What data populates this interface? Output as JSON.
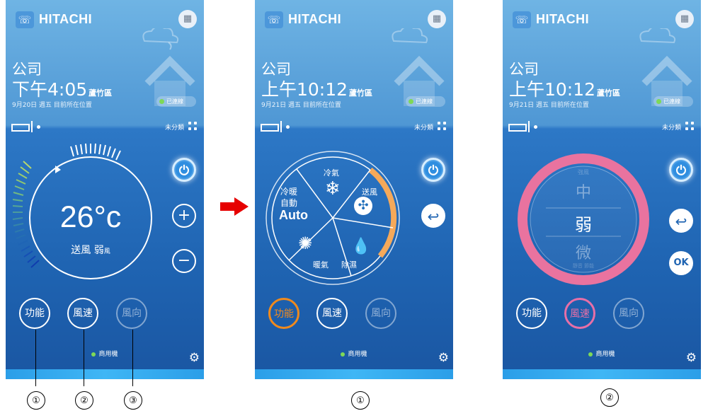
{
  "app": {
    "brand": "HITACHI",
    "brand_color": "#1f64b2",
    "accent_orange": "#f08a1d",
    "accent_pink": "#e76fa7"
  },
  "screens": [
    {
      "location": "公司",
      "time": "下午4:05",
      "district": "蘆竹區",
      "date_line": "9月20日 週五  目前所在位置",
      "connection": "已連線",
      "group_label": "未分類",
      "temperature": "26°c",
      "mode_text": "送風",
      "speed_text": "弱",
      "speed_suffix": "風",
      "buttons": [
        "功能",
        "風速",
        "風向"
      ],
      "commercial": "商用機"
    },
    {
      "location": "公司",
      "time": "上午10:12",
      "district": "蘆竹區",
      "date_line": "9月21日 週五  目前所在位置",
      "connection": "已連線",
      "group_label": "未分類",
      "wheel": {
        "cool": "冷氣",
        "fan": "送風",
        "dehumid": "除濕",
        "heat": "暖氣",
        "auto_top": "冷暖",
        "auto_mid": "自動",
        "auto_big": "Auto"
      },
      "buttons": [
        "功能",
        "風速",
        "風向"
      ],
      "commercial": "商用機"
    },
    {
      "location": "公司",
      "time": "上午10:12",
      "district": "蘆竹區",
      "date_line": "9月21日 週五  目前所在位置",
      "connection": "已連線",
      "group_label": "未分類",
      "speed_options": {
        "top_faint": "強風",
        "upper": "中",
        "selected": "弱",
        "lower": "微",
        "bottom_faint": "靜音 節能"
      },
      "ok_label": "OK",
      "buttons": [
        "功能",
        "風速",
        "風向"
      ],
      "commercial": "商用機"
    }
  ],
  "callouts": {
    "a": "①",
    "b": "②",
    "c": "③",
    "d": "①",
    "e": "②"
  },
  "icons": {
    "power": "power-icon",
    "plus": "plus-icon",
    "minus": "minus-icon",
    "back": "back-icon",
    "gear": "gear-icon",
    "calendar": "calendar-icon",
    "snow": "snowflake-icon",
    "fan": "fan-icon",
    "drop": "droplet-icon",
    "sun": "sun-icon"
  }
}
